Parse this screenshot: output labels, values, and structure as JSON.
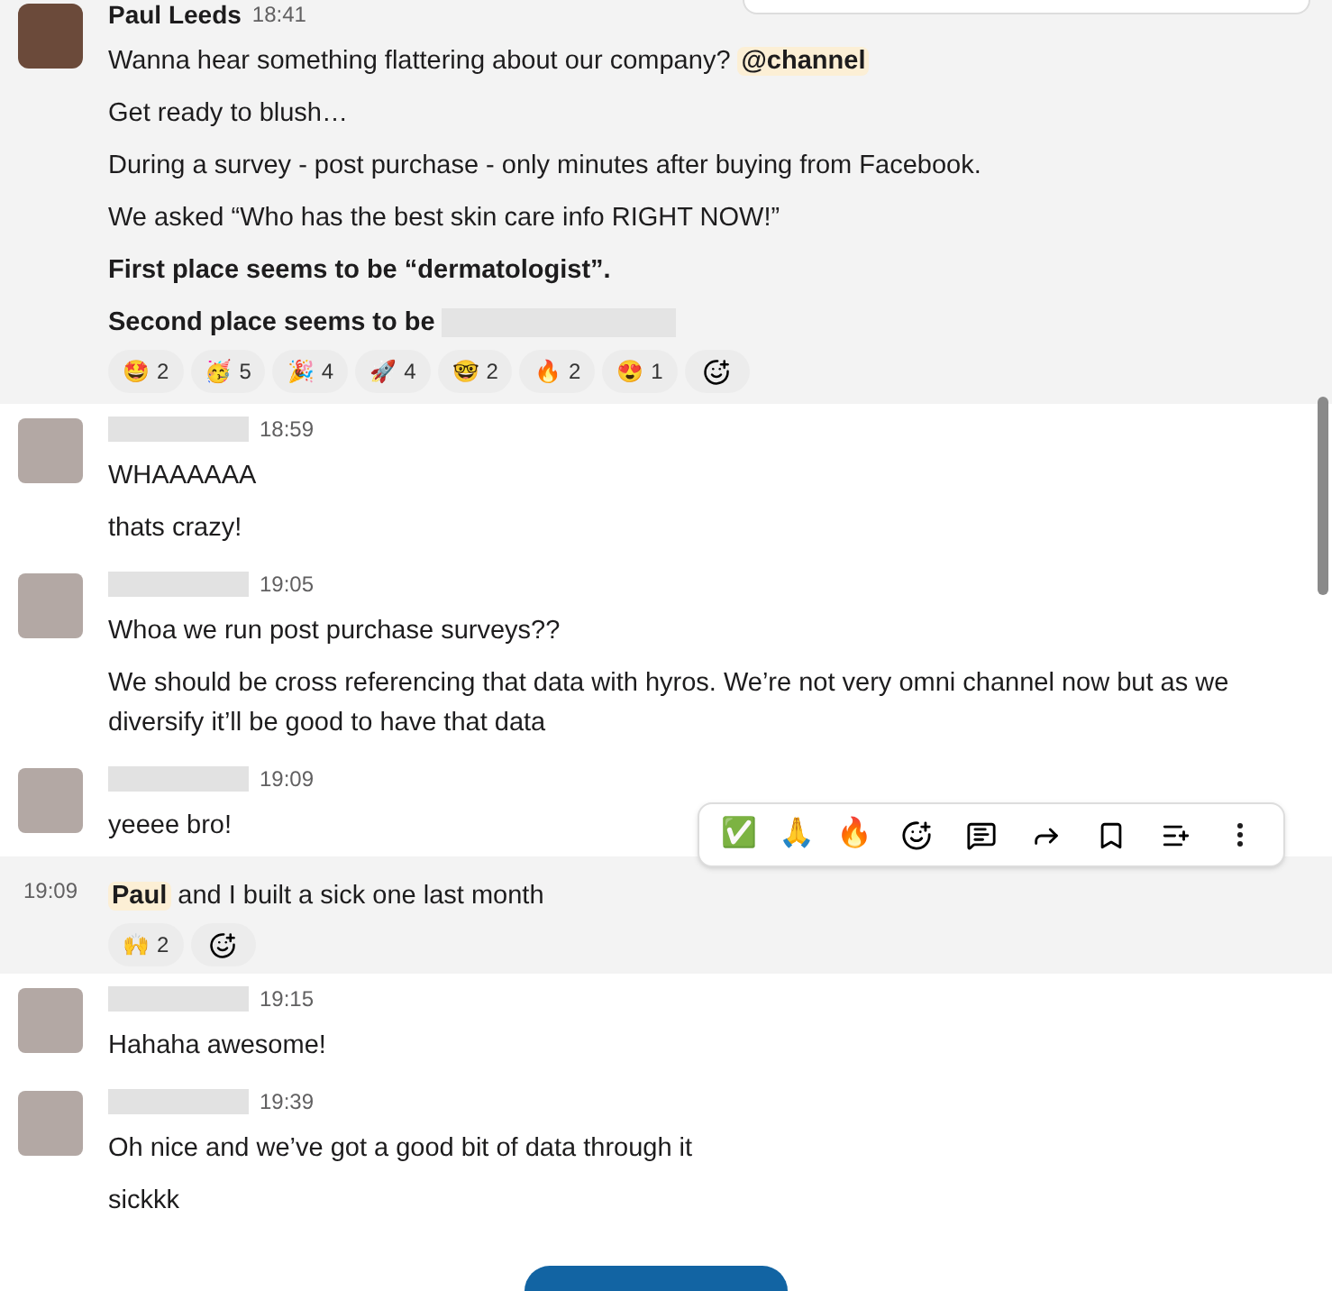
{
  "messages": [
    {
      "avatar": {
        "kind": "photo"
      },
      "author": "Paul Leeds",
      "time": "18:41",
      "highlighted": true,
      "lines": [
        [
          {
            "kind": "text",
            "text": "Wanna hear something flattering about our company? "
          },
          {
            "kind": "mention",
            "text": "@channel"
          }
        ],
        [
          {
            "kind": "text",
            "text": "Get ready to blush…"
          }
        ],
        [
          {
            "kind": "text",
            "text": "During a survey - post purchase - only minutes after buying from Facebook."
          }
        ],
        [
          {
            "kind": "text",
            "text": "We asked “Who has the best skin care info RIGHT NOW!”"
          }
        ],
        [
          {
            "kind": "bold",
            "text": "First place seems to be “dermatologist”."
          }
        ],
        [
          {
            "kind": "bold",
            "text": "Second place seems to be"
          },
          {
            "kind": "redacted"
          }
        ]
      ],
      "reactions": [
        {
          "emoji": "🤩",
          "count": "2"
        },
        {
          "emoji": "🥳",
          "count": "5"
        },
        {
          "emoji": "🎉",
          "count": "4"
        },
        {
          "emoji": "🚀",
          "count": "4"
        },
        {
          "emoji": "🤓",
          "count": "2"
        },
        {
          "emoji": "🔥",
          "count": "2"
        },
        {
          "emoji": "😍",
          "count": "1"
        }
      ]
    },
    {
      "avatar": {
        "kind": "pixelated"
      },
      "time": "18:59",
      "highlighted": false,
      "lines": [
        [
          {
            "kind": "text",
            "text": "WHAAAAAA"
          }
        ],
        [
          {
            "kind": "text",
            "text": "thats crazy!"
          }
        ]
      ]
    },
    {
      "avatar": {
        "kind": "pixelated"
      },
      "time": "19:05",
      "highlighted": false,
      "lines": [
        [
          {
            "kind": "text",
            "text": "Whoa we run post purchase surveys??"
          }
        ],
        [
          {
            "kind": "text",
            "text": "We should be cross referencing that data with hyros. We’re not very omni channel now but as we diversify it’ll be good to have that data"
          }
        ]
      ]
    },
    {
      "avatar": {
        "kind": "pixelated"
      },
      "time": "19:09",
      "highlighted": false,
      "lines": [
        [
          {
            "kind": "text",
            "text": "yeeee bro!"
          }
        ]
      ]
    },
    {
      "continuation": true,
      "time": "19:09",
      "highlighted": true,
      "lines": [
        [
          {
            "kind": "mention",
            "text": "Paul"
          },
          {
            "kind": "text",
            "text": " and I built a sick one last month"
          }
        ]
      ],
      "reactions": [
        {
          "emoji": "🙌",
          "count": "2"
        }
      ]
    },
    {
      "avatar": {
        "kind": "pixelated"
      },
      "time": "19:15",
      "highlighted": false,
      "lines": [
        [
          {
            "kind": "text",
            "text": "Hahaha awesome!"
          }
        ]
      ]
    },
    {
      "avatar": {
        "kind": "pixelated"
      },
      "time": "19:39",
      "highlighted": false,
      "lines": [
        [
          {
            "kind": "text",
            "text": "Oh nice and we’ve got a good bit of data through it"
          }
        ],
        [
          {
            "kind": "text",
            "text": "sickkk"
          }
        ]
      ]
    }
  ],
  "hover_toolbar": {
    "emojis": [
      "✅",
      "🙏",
      "🔥"
    ]
  }
}
